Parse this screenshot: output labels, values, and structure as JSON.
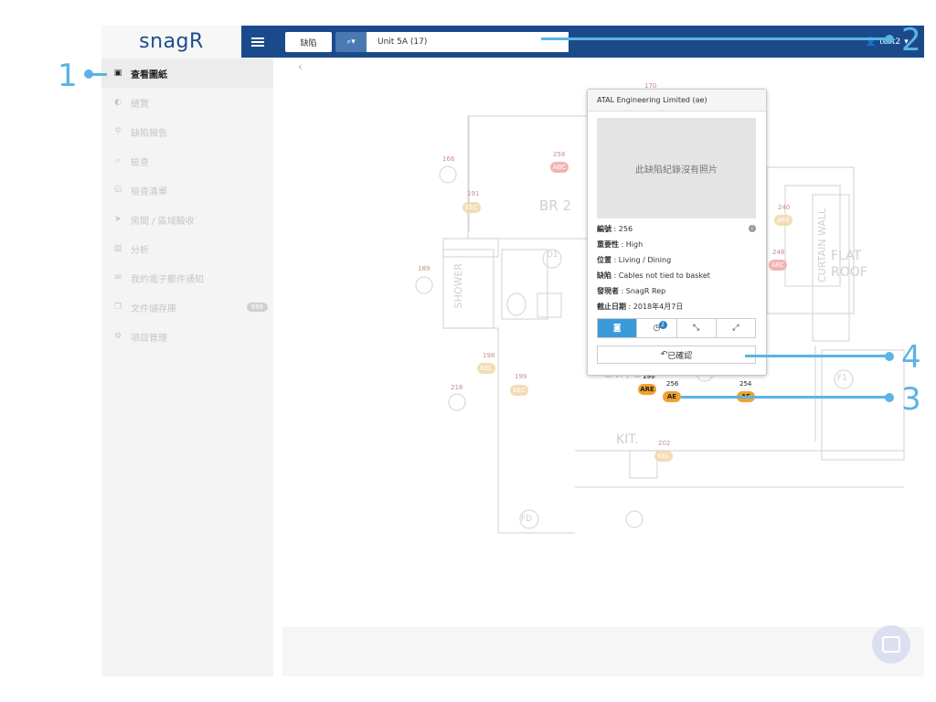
{
  "app": {
    "logo_text": "snagR"
  },
  "sidebar": {
    "items": [
      {
        "label": "查看圖紙",
        "icon": "image-icon"
      },
      {
        "label": "總覽",
        "icon": "dashboard-icon"
      },
      {
        "label": "缺陷報告",
        "icon": "map-marker-icon"
      },
      {
        "label": "檢查",
        "icon": "search-icon"
      },
      {
        "label": "檢查清單",
        "icon": "checklist-icon"
      },
      {
        "label": "房間 / 區域驗收",
        "icon": "send-icon"
      },
      {
        "label": "分析",
        "icon": "bar-chart-icon"
      },
      {
        "label": "我的電子郵件通知",
        "icon": "envelope-icon"
      },
      {
        "label": "文件儲存庫",
        "icon": "documents-icon",
        "badge": "999"
      },
      {
        "label": "項目管理",
        "icon": "gears-icon"
      }
    ]
  },
  "header": {
    "type_button": "缺陷",
    "search_value": "Unit 5A (17)",
    "user": "test2"
  },
  "plan": {
    "room_labels": [
      "BR 2",
      "SHOWER",
      "D1",
      "CURTAIN WALL",
      "FLAT ROOF",
      "F1",
      "LIV. / DIN.",
      "KIT.",
      "FD"
    ],
    "pins": [
      {
        "num": "170",
        "code": ""
      },
      {
        "num": "166",
        "code": ""
      },
      {
        "num": "258",
        "code": "ABC"
      },
      {
        "num": "191",
        "code": "EEC"
      },
      {
        "num": "189",
        "code": ""
      },
      {
        "num": "240",
        "code": "ARE"
      },
      {
        "num": "248",
        "code": "ARC"
      },
      {
        "num": "198",
        "code": "KEL"
      },
      {
        "num": "199",
        "code": "EEC"
      },
      {
        "num": "218",
        "code": ""
      },
      {
        "num": "193",
        "code": "ARE"
      },
      {
        "num": "256",
        "code": "AE"
      },
      {
        "num": "254",
        "code": "AE"
      },
      {
        "num": "202",
        "code": "KEL"
      }
    ]
  },
  "popup": {
    "company": "ATAL Engineering Limited (ae)",
    "no_photo_text": "此缺陷紀錄沒有照片",
    "fields": [
      {
        "label": "編號",
        "value": "256"
      },
      {
        "label": "重要性",
        "value": "High"
      },
      {
        "label": "位置",
        "value": "Living / Dining"
      },
      {
        "label": "缺陷",
        "value": "Cables not tied to basket"
      },
      {
        "label": "發現者",
        "value": "SnagR Rep"
      },
      {
        "label": "截止日期",
        "value": "2018年4月7日"
      }
    ],
    "history_badge": "2",
    "ack_button": "已確認"
  },
  "callouts": [
    "1",
    "2",
    "3",
    "4"
  ],
  "colors": {
    "brand": "#1b4a8b",
    "callout": "#5bb4e3",
    "accent": "#3a9ad9"
  }
}
